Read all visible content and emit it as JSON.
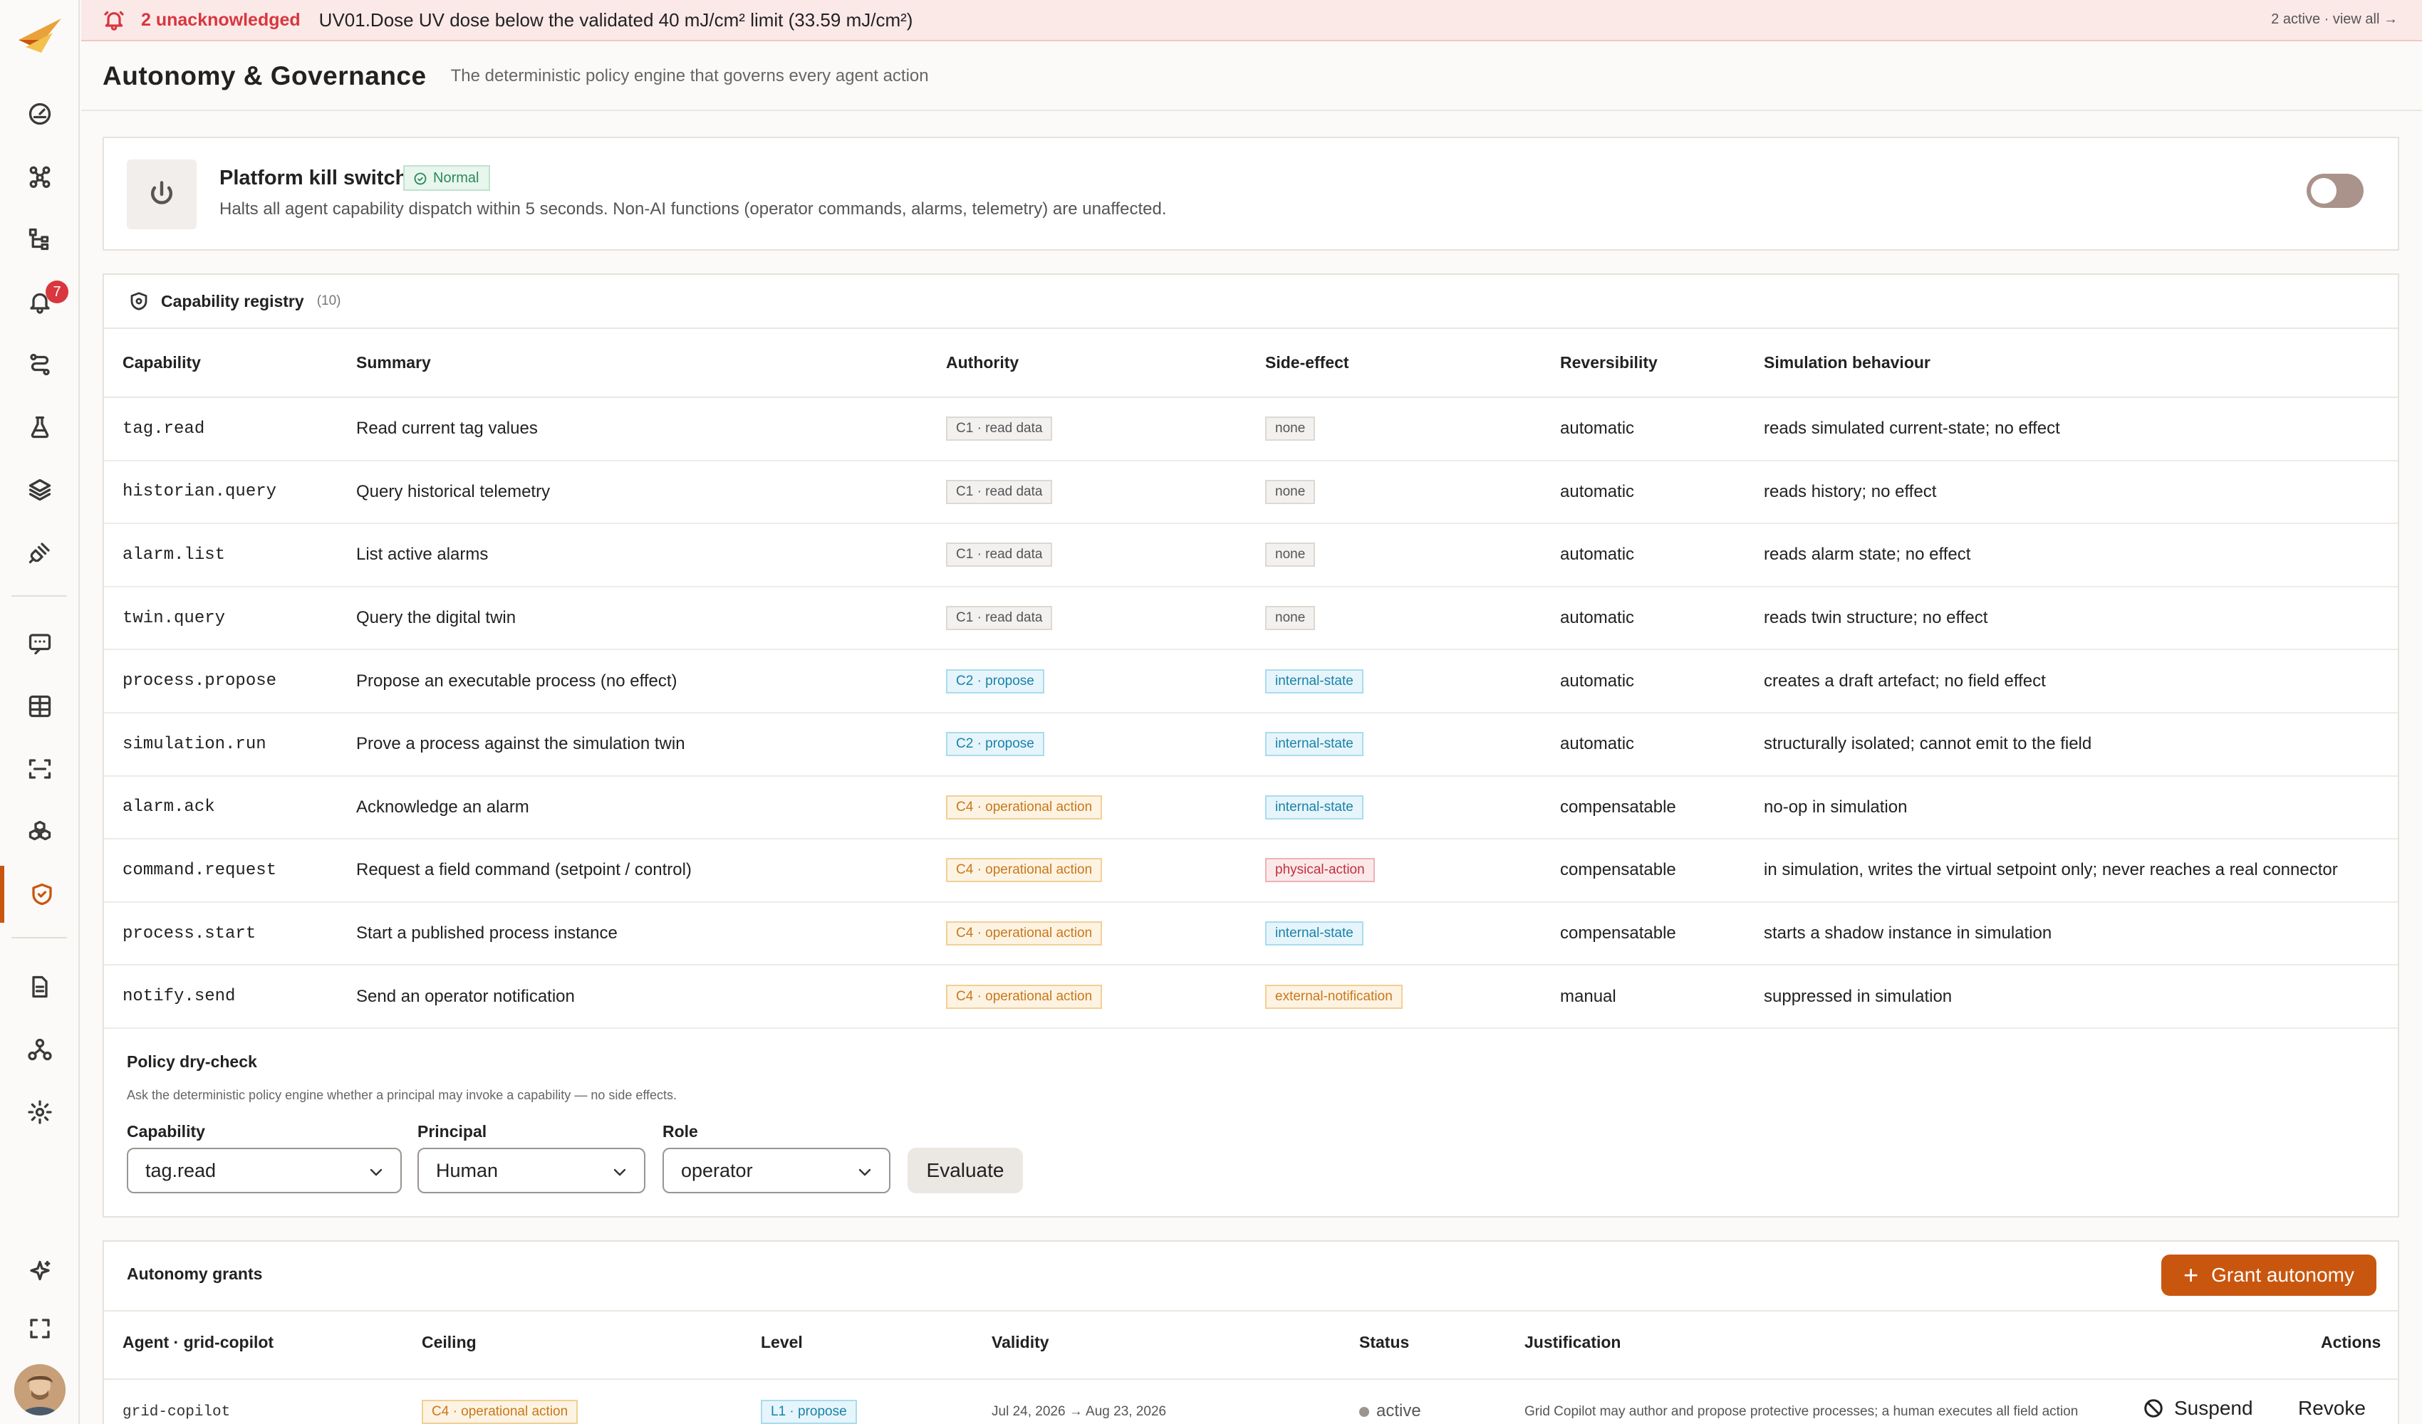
{
  "colors": {
    "accent": "#c9560e",
    "alert": "#d9363e",
    "ok": "#2b8a57"
  },
  "sidebar": {
    "items": [
      {
        "icon": "dashboard-gauge-icon"
      },
      {
        "icon": "nodes-graph-icon"
      },
      {
        "icon": "hierarchy-icon"
      },
      {
        "icon": "alarm-bell-icon",
        "badge": "7"
      },
      {
        "icon": "workflow-route-icon"
      },
      {
        "icon": "flask-icon"
      },
      {
        "icon": "layers-icon"
      },
      {
        "icon": "connector-plug-icon"
      },
      {
        "icon": "chat-message-icon"
      },
      {
        "icon": "table-grid-icon"
      },
      {
        "icon": "scan-icon"
      },
      {
        "icon": "cubes-icon"
      },
      {
        "icon": "shield-check-icon",
        "active": true
      },
      {
        "icon": "document-icon"
      },
      {
        "icon": "org-chart-icon"
      },
      {
        "icon": "settings-gear-icon"
      },
      {
        "icon": "sparkle-ai-icon"
      },
      {
        "icon": "fullscreen-icon"
      }
    ]
  },
  "alert": {
    "count": "2 unacknowledged",
    "message": "UV01.Dose UV dose below the validated 40 mJ/cm² limit (33.59 mJ/cm²)",
    "view_all": "2 active · view all →"
  },
  "header": {
    "title": "Autonomy & Governance",
    "subtitle": "The deterministic policy engine that governs every agent action"
  },
  "kill_switch": {
    "title": "Platform kill switch",
    "status": "Normal",
    "description": "Halts all agent capability dispatch within 5 seconds. Non-AI functions (operator commands, alarms, telemetry) are unaffected.",
    "enabled": false
  },
  "registry": {
    "title": "Capability registry",
    "count": "(10)",
    "columns": [
      "Capability",
      "Summary",
      "Authority",
      "Side-effect",
      "Reversibility",
      "Simulation behaviour"
    ],
    "rows": [
      {
        "capability": "tag.read",
        "summary": "Read current tag values",
        "authority": "C1 · read data",
        "auth_class": "c1",
        "side_effect": "none",
        "se_class": "none",
        "reversibility": "automatic",
        "simulation": "reads simulated current-state; no effect"
      },
      {
        "capability": "historian.query",
        "summary": "Query historical telemetry",
        "authority": "C1 · read data",
        "auth_class": "c1",
        "side_effect": "none",
        "se_class": "none",
        "reversibility": "automatic",
        "simulation": "reads history; no effect"
      },
      {
        "capability": "alarm.list",
        "summary": "List active alarms",
        "authority": "C1 · read data",
        "auth_class": "c1",
        "side_effect": "none",
        "se_class": "none",
        "reversibility": "automatic",
        "simulation": "reads alarm state; no effect"
      },
      {
        "capability": "twin.query",
        "summary": "Query the digital twin",
        "authority": "C1 · read data",
        "auth_class": "c1",
        "side_effect": "none",
        "se_class": "none",
        "reversibility": "automatic",
        "simulation": "reads twin structure; no effect"
      },
      {
        "capability": "process.propose",
        "summary": "Propose an executable process (no effect)",
        "authority": "C2 · propose",
        "auth_class": "c2",
        "side_effect": "internal-state",
        "se_class": "internal",
        "reversibility": "automatic",
        "simulation": "creates a draft artefact; no field effect"
      },
      {
        "capability": "simulation.run",
        "summary": "Prove a process against the simulation twin",
        "authority": "C2 · propose",
        "auth_class": "c2",
        "side_effect": "internal-state",
        "se_class": "internal",
        "reversibility": "automatic",
        "simulation": "structurally isolated; cannot emit to the field"
      },
      {
        "capability": "alarm.ack",
        "summary": "Acknowledge an alarm",
        "authority": "C4 · operational action",
        "auth_class": "c4",
        "side_effect": "internal-state",
        "se_class": "internal",
        "reversibility": "compensatable",
        "simulation": "no-op in simulation"
      },
      {
        "capability": "command.request",
        "summary": "Request a field command (setpoint / control)",
        "authority": "C4 · operational action",
        "auth_class": "c4",
        "side_effect": "physical-action",
        "se_class": "physical",
        "reversibility": "compensatable",
        "simulation": "in simulation, writes the virtual setpoint only; never reaches a real connector"
      },
      {
        "capability": "process.start",
        "summary": "Start a published process instance",
        "authority": "C4 · operational action",
        "auth_class": "c4",
        "side_effect": "internal-state",
        "se_class": "internal",
        "reversibility": "compensatable",
        "simulation": "starts a shadow instance in simulation"
      },
      {
        "capability": "notify.send",
        "summary": "Send an operator notification",
        "authority": "C4 · operational action",
        "auth_class": "c4",
        "side_effect": "external-notification",
        "se_class": "external",
        "reversibility": "manual",
        "simulation": "suppressed in simulation"
      }
    ]
  },
  "dry_check": {
    "title": "Policy dry-check",
    "subtitle": "Ask the deterministic policy engine whether a principal may invoke a capability — no side effects.",
    "capability_label": "Capability",
    "capability_value": "tag.read",
    "principal_label": "Principal",
    "principal_value": "Human",
    "role_label": "Role",
    "role_value": "operator",
    "evaluate_label": "Evaluate"
  },
  "grants": {
    "title": "Autonomy grants",
    "grant_button": "Grant autonomy",
    "columns": [
      "Agent · grid-copilot",
      "Ceiling",
      "Level",
      "Validity",
      "Status",
      "Justification",
      "Actions"
    ],
    "row": {
      "agent": "grid-copilot",
      "ceiling": "C4 · operational action",
      "level": "L1 · propose",
      "validity": "Jul 24, 2026 → Aug 23, 2026",
      "status": "active",
      "justification": "Grid Copilot may author and propose protective processes; a human executes all field action",
      "suspend_label": "Suspend",
      "revoke_label": "Revoke"
    }
  }
}
